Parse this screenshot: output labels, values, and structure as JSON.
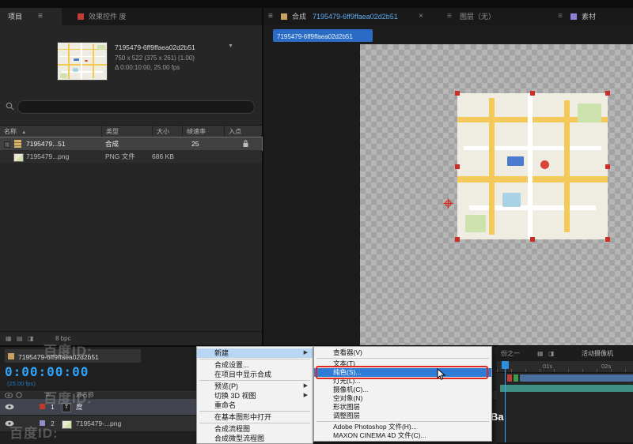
{
  "icons": {
    "hamburger": "≡",
    "sort": "▲",
    "dropdown": "▼",
    "submenu_arrow": "▶",
    "close": "×",
    "grid": "▦",
    "list": "▤",
    "half": "◨"
  },
  "project": {
    "tab_project": "项目",
    "tab_effects": "效果控件 度",
    "preview": {
      "name": "7195479-6ff9ffaea02d2b51",
      "dims": "750 x 522 (375 x 261) (1.00)",
      "timing": "Δ 0:00:10:00, 25.00 fps"
    },
    "columns": {
      "name": "名称",
      "type": "类型",
      "size": "大小",
      "rate": "帧速率",
      "in": "入点"
    },
    "rows": [
      {
        "name": "7195479...51",
        "type": "合成",
        "size": "",
        "rate": "25"
      },
      {
        "name": "7195479...png",
        "type": "PNG 文件",
        "size": "686 KB",
        "rate": ""
      }
    ],
    "bpc": "8 bpc"
  },
  "viewer": {
    "comp_label": "合成",
    "comp_name": "7195479-6ff9ffaea02d2b51",
    "layer_tab": "图层（无）",
    "footage_tab": "素材",
    "comp_chip": "7195479-6ff9ffaea02d2b51",
    "resolution": "份之一",
    "camera": "活动摄像机"
  },
  "timeline": {
    "comp_tab": "7195479-6ff9ffaea02d2b51",
    "timecode": "0:00:00:00",
    "fps": "(25.00 fps)",
    "col_index": "#",
    "col_source": "源名称",
    "layers": [
      {
        "num": "1",
        "icon": "T",
        "name": "度"
      },
      {
        "num": "2",
        "name": "7195479-...png"
      }
    ],
    "ruler_1": "01s",
    "ruler_2": "02s"
  },
  "menu": {
    "items": [
      {
        "label": "新建"
      },
      {
        "label": "合成设置..."
      },
      {
        "label": "在项目中显示合成"
      },
      {
        "label": "预览(P)"
      },
      {
        "label": "切换 3D 视图"
      },
      {
        "label": "重命名"
      },
      {
        "label": "在基本图形中打开"
      },
      {
        "label": "合成流程图"
      },
      {
        "label": "合成微型流程图"
      }
    ]
  },
  "submenu": {
    "items": [
      {
        "label": "查看器(V)"
      },
      {
        "label": "文本(T)"
      },
      {
        "label": "纯色(S)..."
      },
      {
        "label": "灯光(L)..."
      },
      {
        "label": "摄像机(C)..."
      },
      {
        "label": "空对象(N)"
      },
      {
        "label": "形状图层"
      },
      {
        "label": "调整图层"
      },
      {
        "label": "Adobe Photoshop 文件(H)..."
      },
      {
        "label": "MAXON CINEMA 4D 文件(C)..."
      }
    ]
  },
  "watermark": {
    "text": "百度ID:",
    "ba": "Ba"
  },
  "colors": {
    "timecode_blue": "#2fa3f7",
    "menu_highlight": "#2e7cd6",
    "annotation_red": "#e0281e",
    "selection_handle_red": "#cf2d23"
  }
}
